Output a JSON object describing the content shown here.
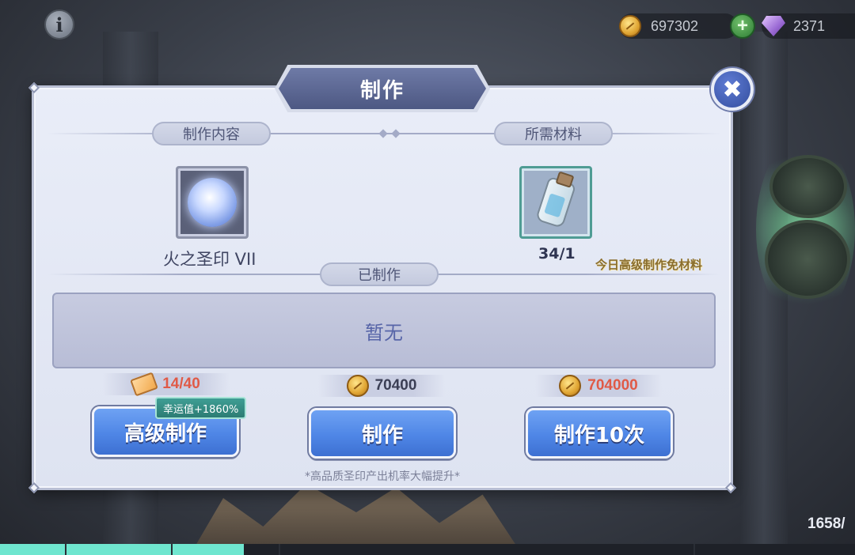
{
  "top_bar": {
    "info_glyph": "i",
    "gold": "697302",
    "plus_glyph": "+",
    "gems": "2371"
  },
  "dialog": {
    "title": "制作",
    "close_glyph": "✖",
    "content_label": "制作内容",
    "materials_label": "所需材料",
    "made_label": "已制作",
    "item_name": "火之圣印 VII",
    "material_count": "34/1",
    "free_note": "今日高级制作免材料",
    "made_empty": "暂无",
    "costs": {
      "advanced": "14/40",
      "single": "70400",
      "ten": "704000"
    },
    "luck_badge": "幸运值+1860%",
    "buttons": {
      "advanced": "高级制作",
      "single": "制作",
      "ten": "制作10次"
    },
    "footnote": "*高品质圣印产出机率大幅提升*"
  },
  "bottom": {
    "energy_text": "1658/",
    "progress_fraction": 0.285
  },
  "icons": [
    "info-icon",
    "gold-coin-icon",
    "add-icon",
    "gem-icon",
    "close-icon",
    "seal-icon",
    "bottle-icon",
    "ticket-icon"
  ],
  "colors": {
    "button_blue": "#4f86e6",
    "cost_red": "#e05a47",
    "panel_bg": "#e9edf8",
    "progress": "#6fe6cf"
  }
}
